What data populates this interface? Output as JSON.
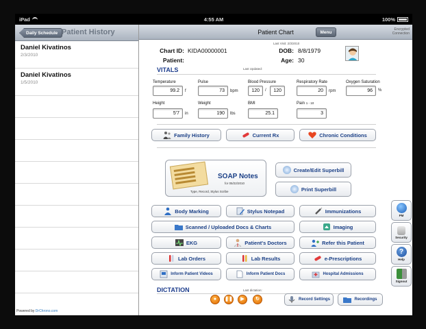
{
  "status_bar": {
    "device": "iPad",
    "time": "4:55 AM",
    "battery": "100%"
  },
  "left_pane": {
    "back_label": "Daily Schedule",
    "title": "Patient History",
    "items": [
      {
        "name": "Daniel Kivatinos",
        "date": "2/3/2010"
      },
      {
        "name": "Daniel Kivatinos",
        "date": "1/5/2010"
      }
    ],
    "powered_prefix": "Powered by",
    "powered_brand": "DrChrono.com"
  },
  "header": {
    "title": "Patient Chart",
    "menu_label": "Menu",
    "encryption_line1": "Encrypted",
    "encryption_line2": "Connection"
  },
  "patient": {
    "last_visit": "Last Visit: 2/3/2010",
    "chart_id_label": "Chart ID:",
    "chart_id": "KIDA00000001",
    "dob_label": "DOB:",
    "dob": "8/8/1979",
    "patient_label": "Patient:",
    "patient_name": "",
    "age_label": "Age:",
    "age": "30"
  },
  "vitals": {
    "section_label": "VITALS",
    "last_updated": "Last Updated:",
    "temperature": {
      "label": "Temperature",
      "value": "99.2",
      "unit": "f"
    },
    "pulse": {
      "label": "Pulse",
      "value": "73",
      "unit": "bpm"
    },
    "blood_pressure": {
      "label": "Blood Pressure",
      "systolic": "120",
      "separator": "/",
      "diastolic": "120"
    },
    "respiratory_rate": {
      "label": "Respiratory Rate",
      "value": "20",
      "unit": "rpm"
    },
    "oxygen_saturation": {
      "label": "Oxygen Saturation",
      "value": "96",
      "unit": "%"
    },
    "height": {
      "label": "Height",
      "value": "5'7",
      "unit": "in"
    },
    "weight": {
      "label": "Weight",
      "value": "190",
      "unit": "lbs"
    },
    "bmi": {
      "label": "BMI",
      "value": "25.1"
    },
    "pain": {
      "label": "Pain",
      "range": "1 - 10",
      "value": "3"
    }
  },
  "buttons": {
    "family_history": "Family History",
    "current_rx": "Current Rx",
    "chronic_conditions": "Chronic Conditions",
    "soap_title": "SOAP Notes",
    "soap_for": "for 05/22/2010",
    "soap_sub": "Type, Record, Stylus Scribe",
    "create_superbill": "Create/Edit Superbill",
    "print_superbill": "Print Superbill",
    "body_marking": "Body Marking",
    "stylus_notepad": "Stylus Notepad",
    "immunizations": "Immunizations",
    "scanned_docs": "Scanned / Uploaded Docs & Charts",
    "imaging": "Imaging",
    "ekg": "EKG",
    "patients_doctors": "Patient's Doctors",
    "refer_patient": "Refer this Patient",
    "lab_orders": "Lab Orders",
    "lab_results": "Lab Results",
    "e_prescriptions": "e-Prescriptions",
    "inform_videos": "Inform Patient Videos",
    "inform_docs": "Inform Patient Docs",
    "hospital_admissions": "Hospital Admissions"
  },
  "side_buttons": {
    "pm": "PM",
    "security": "Security",
    "help": "Help",
    "signout": "Signout"
  },
  "dictation": {
    "section_label": "DICTATION",
    "last_dictation": "Last dictation:",
    "record_settings": "Record Settings",
    "recordings": "Recordings"
  },
  "colors": {
    "accent_blue": "#1a3f86",
    "section_blue": "#1d3d8c",
    "control_orange": "#e06a00"
  }
}
